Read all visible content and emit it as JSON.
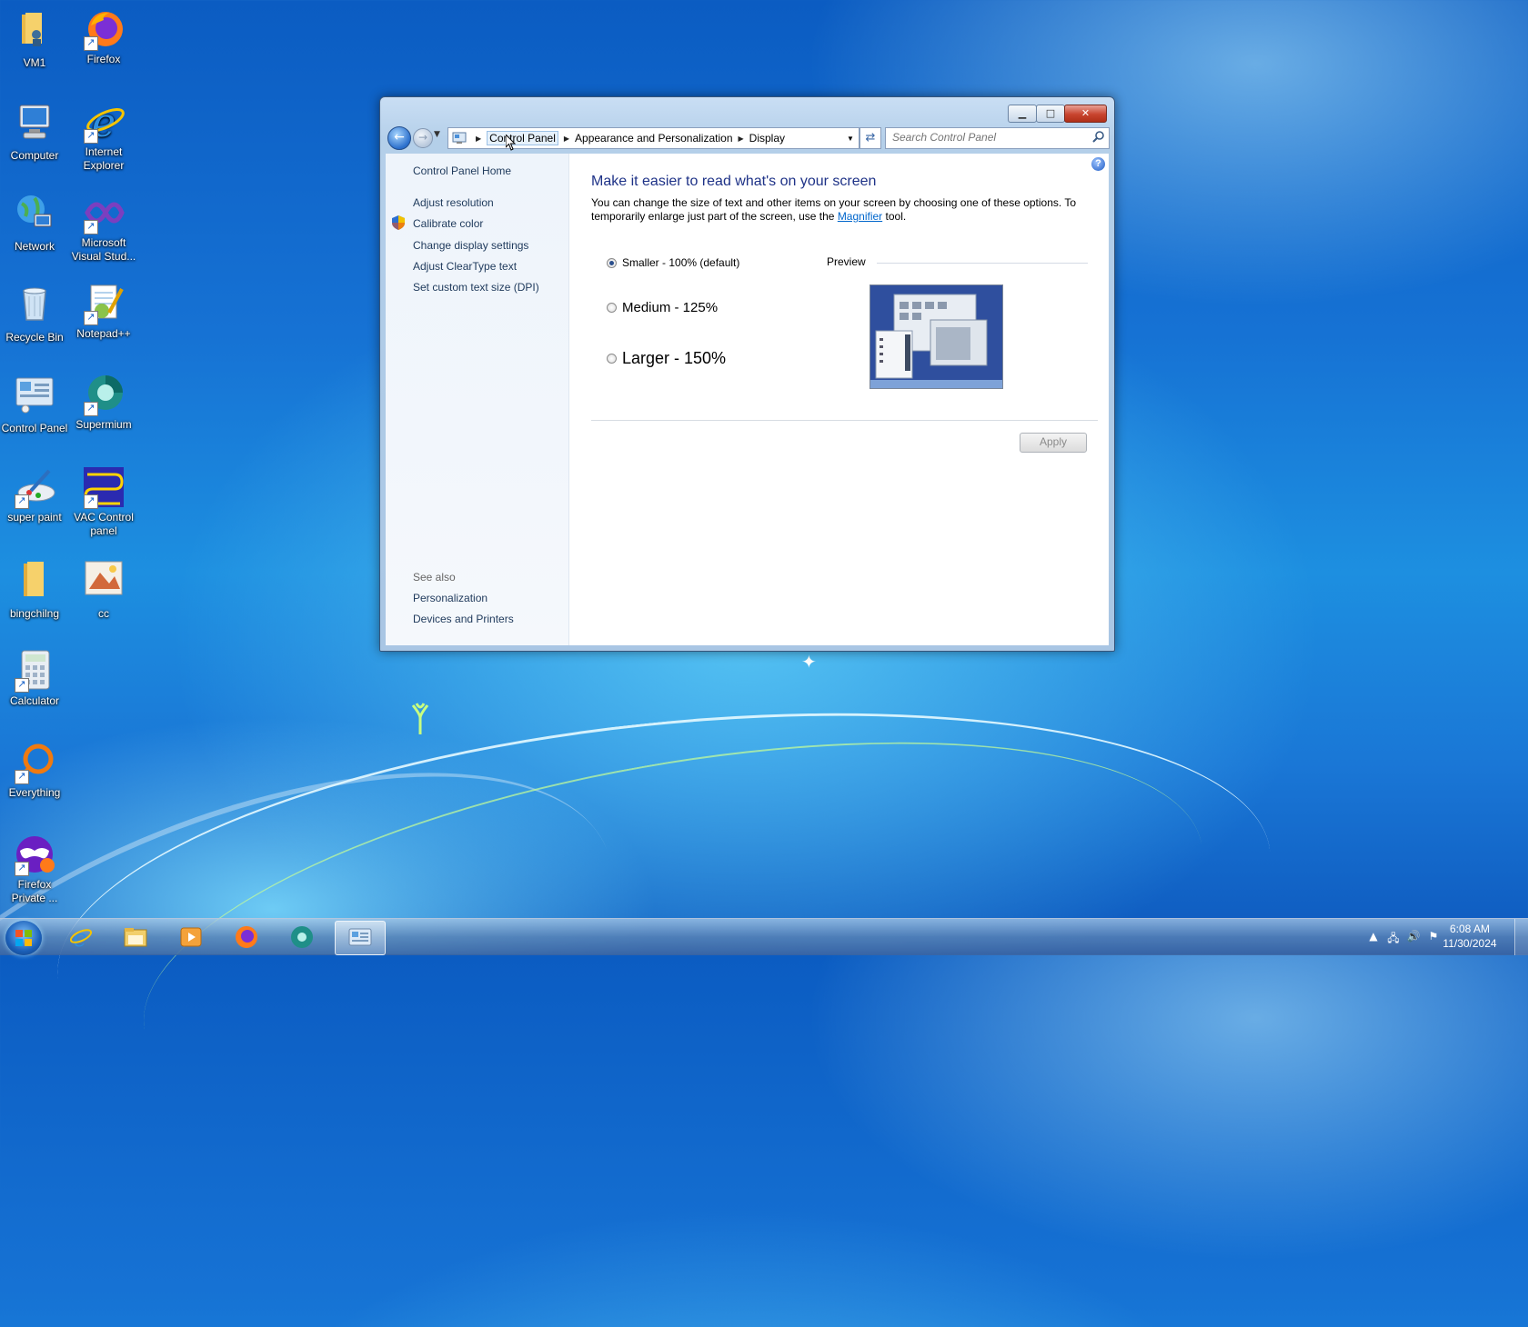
{
  "desktop": {
    "icons": [
      {
        "label": "VM1",
        "icon": "folder-user-icon"
      },
      {
        "label": "Firefox",
        "icon": "firefox-icon"
      },
      {
        "label": "Computer",
        "icon": "computer-icon"
      },
      {
        "label": "Internet Explorer",
        "icon": "internet-explorer-icon"
      },
      {
        "label": "Network",
        "icon": "network-icon"
      },
      {
        "label": "Microsoft Visual Stud...",
        "icon": "visual-studio-icon"
      },
      {
        "label": "Recycle Bin",
        "icon": "recycle-bin-icon"
      },
      {
        "label": "Notepad++",
        "icon": "notepad-plus-plus-icon"
      },
      {
        "label": "Control Panel",
        "icon": "control-panel-icon"
      },
      {
        "label": "Supermium",
        "icon": "supermium-icon"
      },
      {
        "label": "super paint",
        "icon": "super-paint-icon"
      },
      {
        "label": "VAC Control panel",
        "icon": "vac-control-panel-icon"
      },
      {
        "label": "bingchilng",
        "icon": "folder-icon"
      },
      {
        "label": "cc",
        "icon": "image-file-icon"
      },
      {
        "label": "Calculator",
        "icon": "calculator-icon"
      },
      {
        "label": "Everything",
        "icon": "everything-search-icon"
      },
      {
        "label": "Firefox Private ...",
        "icon": "firefox-private-icon"
      }
    ]
  },
  "window": {
    "address": {
      "crumbs": [
        "Control Panel",
        "Appearance and Personalization",
        "Display"
      ]
    },
    "search": {
      "placeholder": "Search Control Panel"
    },
    "controls": {
      "min": "▁",
      "max": "□",
      "close": "✕"
    }
  },
  "leftpane": {
    "home": "Control Panel Home",
    "links": [
      "Adjust resolution",
      "Calibrate color",
      "Change display settings",
      "Adjust ClearType text",
      "Set custom text size (DPI)"
    ],
    "see_also_title": "See also",
    "see_also": [
      "Personalization",
      "Devices and Printers"
    ]
  },
  "main": {
    "heading": "Make it easier to read what's on your screen",
    "desc_before": "You can change the size of text and other items on your screen by choosing one of these options. To temporarily enlarge just part of the screen, use the ",
    "desc_link": "Magnifier",
    "desc_after": " tool.",
    "options": [
      {
        "label": "Smaller - 100% (default)",
        "selected": true
      },
      {
        "label": "Medium - 125%",
        "selected": false
      },
      {
        "label": "Larger - 150%",
        "selected": false
      }
    ],
    "preview_label": "Preview",
    "apply_label": "Apply",
    "help_label": "?"
  },
  "taskbar": {
    "apps": [
      "internet-explorer-icon",
      "file-explorer-icon",
      "media-player-icon",
      "firefox-icon",
      "supermium-icon",
      "control-panel-icon"
    ],
    "active_app": "control-panel-icon",
    "clock_time": "6:08 AM",
    "clock_date": "11/30/2024"
  }
}
